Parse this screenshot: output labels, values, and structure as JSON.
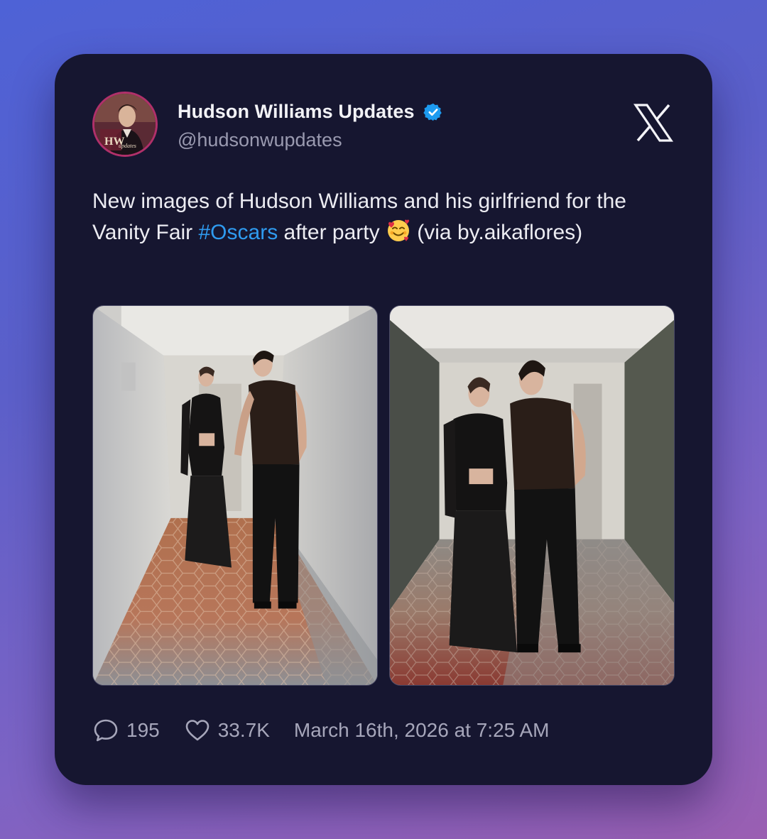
{
  "tweet": {
    "author": {
      "display_name": "Hudson Williams Updates",
      "handle": "@hudsonwupdates",
      "verified": true,
      "avatar_label": "HW updates"
    },
    "text": {
      "part1": "New images of Hudson Williams and his girlfriend for the Vanity Fair ",
      "hashtag": "#Oscars",
      "part2": " after party ",
      "emoji": "smiling-face-with-hearts-emoji",
      "part3": " (via by.aikaflores)"
    },
    "photos": [
      {
        "name": "hallway-photo-walking"
      },
      {
        "name": "hallway-photo-posing"
      }
    ],
    "stats": {
      "replies": "195",
      "likes": "33.7K",
      "timestamp": "March 16th, 2026 at 7:25 AM"
    },
    "icons": {
      "platform": "x-logo-icon",
      "verified": "verified-badge-icon",
      "reply": "reply-icon",
      "like": "heart-icon"
    }
  },
  "colors": {
    "background_top": "#4e62d6",
    "background_bottom": "#9a5fb2",
    "card": "#161630",
    "hashtag": "#2f9bf0",
    "verified": "#1d9bf0",
    "avatar_ring": "#b0306a",
    "muted_text": "#9a9ab0"
  }
}
